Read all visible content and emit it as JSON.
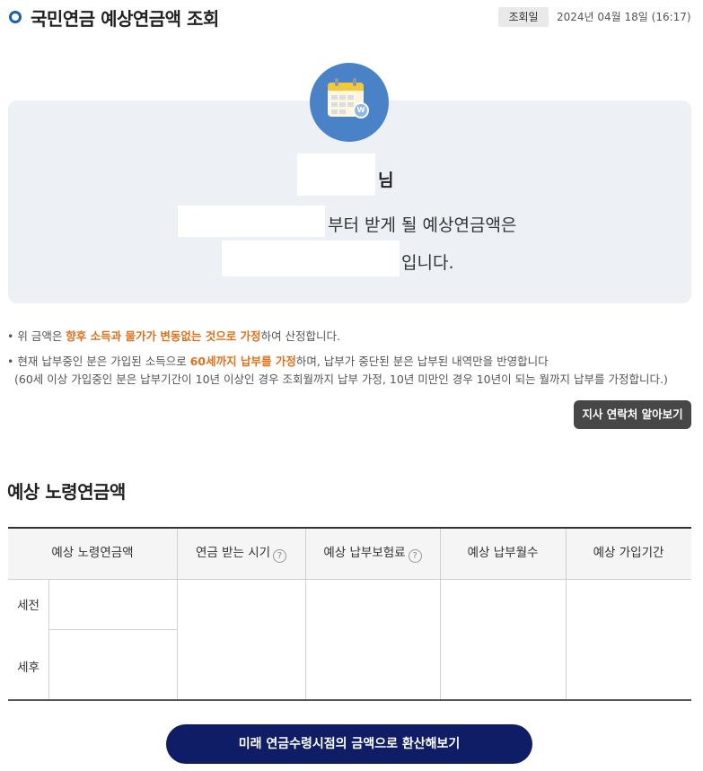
{
  "header": {
    "title": "국민연금 예상연금액 조회",
    "query_label": "조회일",
    "query_date": "2024년 04월 18일 (16:17)"
  },
  "summary": {
    "name_suffix": "님",
    "start_line_suffix": "부터 받게 될 예상연금액은",
    "amount_line_suffix": "입니다."
  },
  "notes": {
    "note1_pre": "• 위 금액은 ",
    "note1_hl": "향후 소득과 물가가 변동없는 것으로 가정",
    "note1_post": "하여 산정합니다.",
    "note2_pre": "• 현재 납부중인 분은 가입된 소득으로 ",
    "note2_hl": "60세까지 납부를 가정",
    "note2_post": "하며, 납부가 중단된 분은 납부된 내역만을 반영합니다",
    "note3": "(60세 이상 가입중인 분은 납부기간이 10년 이상인 경우 조회월까지 납부 가정, 10년 미만인 경우 10년이 되는 월까지 납부를 가정합니다.)"
  },
  "branch_button": "지사 연락처 알아보기",
  "section": {
    "title": "예상 노령연금액"
  },
  "table": {
    "headers": [
      "예상 노령연금액",
      "연금 받는 시기",
      "예상 납부보험료",
      "예상 납부월수",
      "예상 가입기간"
    ],
    "help_mark": "?",
    "rows": [
      "세전",
      "세후"
    ]
  },
  "convert_button": "미래 연금수령시점의 금액으로 환산해보기",
  "colors": {
    "accent_blue": "#1a5fb4",
    "highlight_orange": "#e0701a",
    "button_dark": "#474747",
    "button_navy": "#0f1d66",
    "summary_bg": "#edf1f5"
  }
}
